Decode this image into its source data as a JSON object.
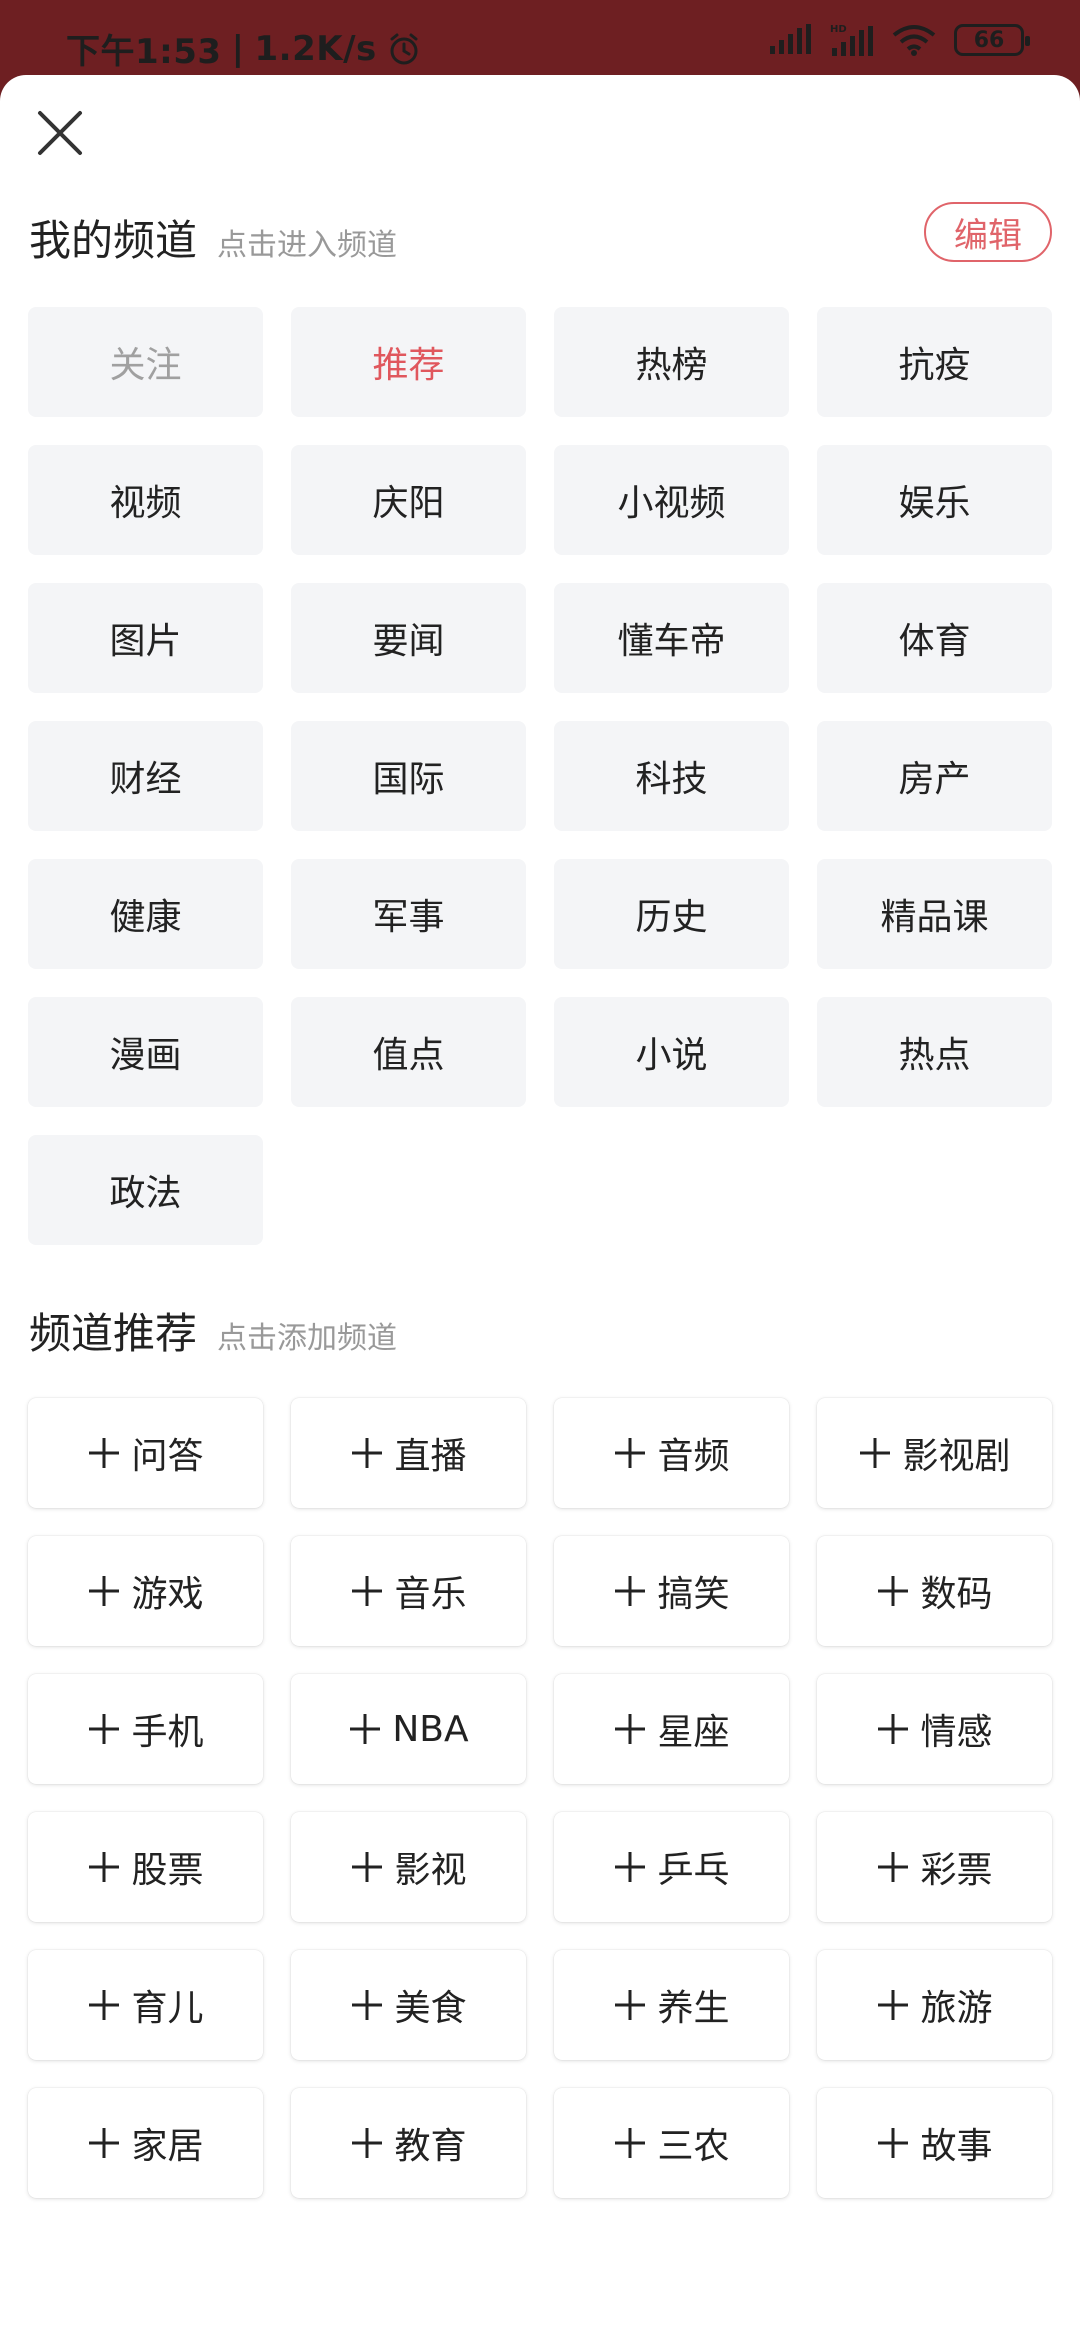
{
  "status_bar": {
    "time": "下午1:53",
    "speed": "1.2K/s",
    "battery": "66"
  },
  "my_channels": {
    "title": "我的频道",
    "hint": "点击进入频道",
    "edit_label": "编辑",
    "items": [
      {
        "label": "关注",
        "state": "muted"
      },
      {
        "label": "推荐",
        "state": "active"
      },
      {
        "label": "热榜"
      },
      {
        "label": "抗疫"
      },
      {
        "label": "视频"
      },
      {
        "label": "庆阳"
      },
      {
        "label": "小视频"
      },
      {
        "label": "娱乐"
      },
      {
        "label": "图片"
      },
      {
        "label": "要闻"
      },
      {
        "label": "懂车帝"
      },
      {
        "label": "体育"
      },
      {
        "label": "财经"
      },
      {
        "label": "国际"
      },
      {
        "label": "科技"
      },
      {
        "label": "房产"
      },
      {
        "label": "健康"
      },
      {
        "label": "军事"
      },
      {
        "label": "历史"
      },
      {
        "label": "精品课"
      },
      {
        "label": "漫画"
      },
      {
        "label": "值点"
      },
      {
        "label": "小说"
      },
      {
        "label": "热点"
      },
      {
        "label": "政法"
      }
    ]
  },
  "recommended_channels": {
    "title": "频道推荐",
    "hint": "点击添加频道",
    "items": [
      "问答",
      "直播",
      "音频",
      "影视剧",
      "游戏",
      "音乐",
      "搞笑",
      "数码",
      "手机",
      "NBA",
      "星座",
      "情感",
      "股票",
      "影视",
      "乒乓",
      "彩票",
      "育儿",
      "美食",
      "养生",
      "旅游",
      "家居",
      "教育",
      "三农",
      "故事"
    ]
  },
  "colors": {
    "accent": "#e0575d",
    "status_bar_bg": "#6e1f22",
    "chip_bg": "#f4f5f7"
  }
}
